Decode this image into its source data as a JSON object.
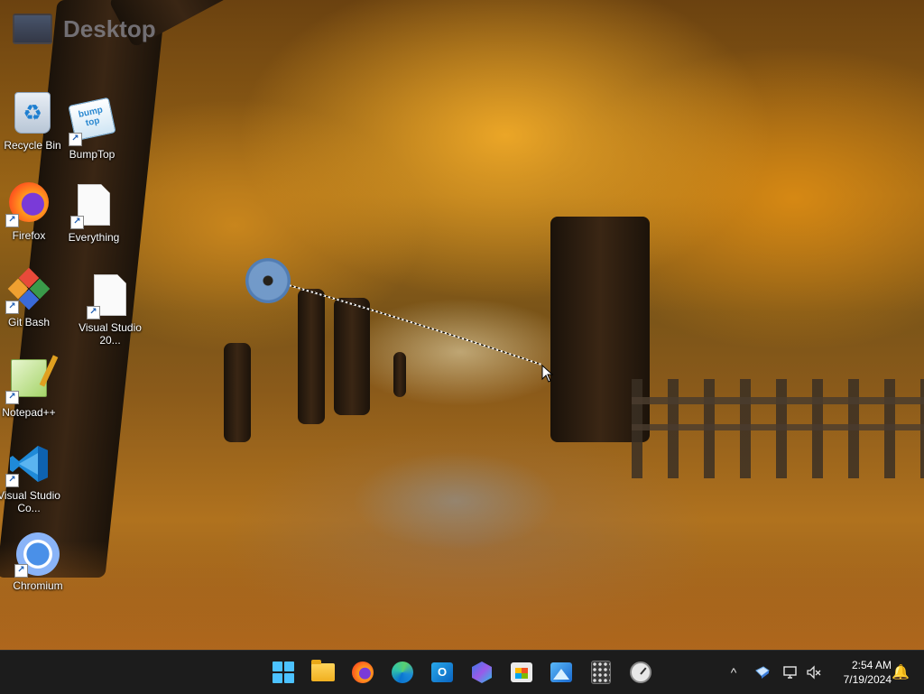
{
  "desktop": {
    "title": "Desktop",
    "icons": [
      {
        "label": "Recycle Bin"
      },
      {
        "label": "BumpTop",
        "art_text": "bump top"
      },
      {
        "label": "Firefox"
      },
      {
        "label": "Everything"
      },
      {
        "label": "Git Bash"
      },
      {
        "label": "Visual Studio 20..."
      },
      {
        "label": "Notepad++"
      },
      {
        "label": "Visual Studio Co..."
      },
      {
        "label": "Chromium"
      }
    ]
  },
  "taskbar": {
    "apps": [
      {
        "name": "start",
        "icon": "windows-start-icon"
      },
      {
        "name": "file-explorer",
        "icon": "folder-icon"
      },
      {
        "name": "firefox",
        "icon": "firefox-icon"
      },
      {
        "name": "edge",
        "icon": "edge-icon"
      },
      {
        "name": "outlook",
        "icon": "outlook-icon",
        "art_text": "O"
      },
      {
        "name": "copilot",
        "icon": "copilot-icon"
      },
      {
        "name": "store",
        "icon": "store-icon"
      },
      {
        "name": "photos",
        "icon": "photos-icon"
      },
      {
        "name": "calculator",
        "icon": "calculator-icon"
      },
      {
        "name": "clock",
        "icon": "clock-icon"
      }
    ],
    "tray": {
      "chevron": "^",
      "clock_time": "2:54 AM",
      "clock_date": "7/19/2024"
    }
  },
  "colors": {
    "taskbar_bg": "#1c1c1c",
    "start_accent": "#4cc2ff",
    "notification_accent": "#f0a020"
  }
}
